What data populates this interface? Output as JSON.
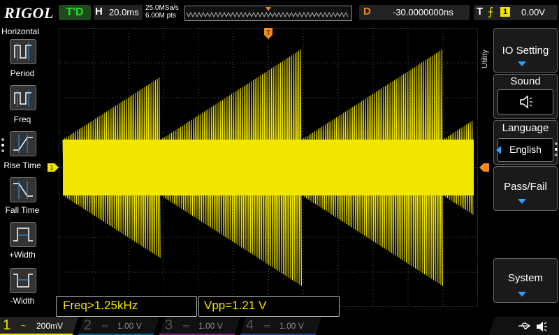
{
  "brand": {
    "logo": "RIGOL"
  },
  "status": {
    "run_state": "T'D"
  },
  "horizontal": {
    "h_label": "H",
    "timebase": "20.0ms",
    "sample_rate": "25.0MSa/s",
    "memory_depth": "6.00M pts"
  },
  "delay": {
    "label": "D",
    "value": "-30.0000000ns"
  },
  "trigger": {
    "label": "T",
    "source": "1",
    "level": "0.00V"
  },
  "left_menu": {
    "title": "Horizontal",
    "items": [
      {
        "label": "Period"
      },
      {
        "label": "Freq"
      },
      {
        "label": "Rise Time"
      },
      {
        "label": "Fall Time"
      },
      {
        "label": "+Width"
      },
      {
        "label": "-Width"
      }
    ]
  },
  "right_menu": {
    "utility_label": "Utility",
    "io_setting": "IO Setting",
    "sound": "Sound",
    "language": "Language",
    "language_value": "English",
    "pass_fail": "Pass/Fail",
    "system": "System"
  },
  "measurements": {
    "freq": "Freq>1.25kHz",
    "vpp": "Vpp=1.21 V"
  },
  "channels": [
    {
      "num": "1",
      "coupling": "~",
      "scale": "200mV",
      "color": "#f2e600"
    },
    {
      "num": "2",
      "scale": "1.00 V",
      "color": "#00b4ff"
    },
    {
      "num": "3",
      "scale": "1.00 V",
      "color": "#e040e0"
    },
    {
      "num": "4",
      "scale": "1.00 V",
      "color": "#3c6cff"
    }
  ],
  "markers": {
    "ch1_marker": "1",
    "trig_marker": "T"
  },
  "colors": {
    "trace": "#f2e600",
    "trigger_orange": "#f28a1c",
    "accent_blue": "#2aa0ff"
  },
  "icons": {
    "sound": "speaker-icon",
    "usb": "usb-icon",
    "speaker_status": "speaker-icon"
  }
}
